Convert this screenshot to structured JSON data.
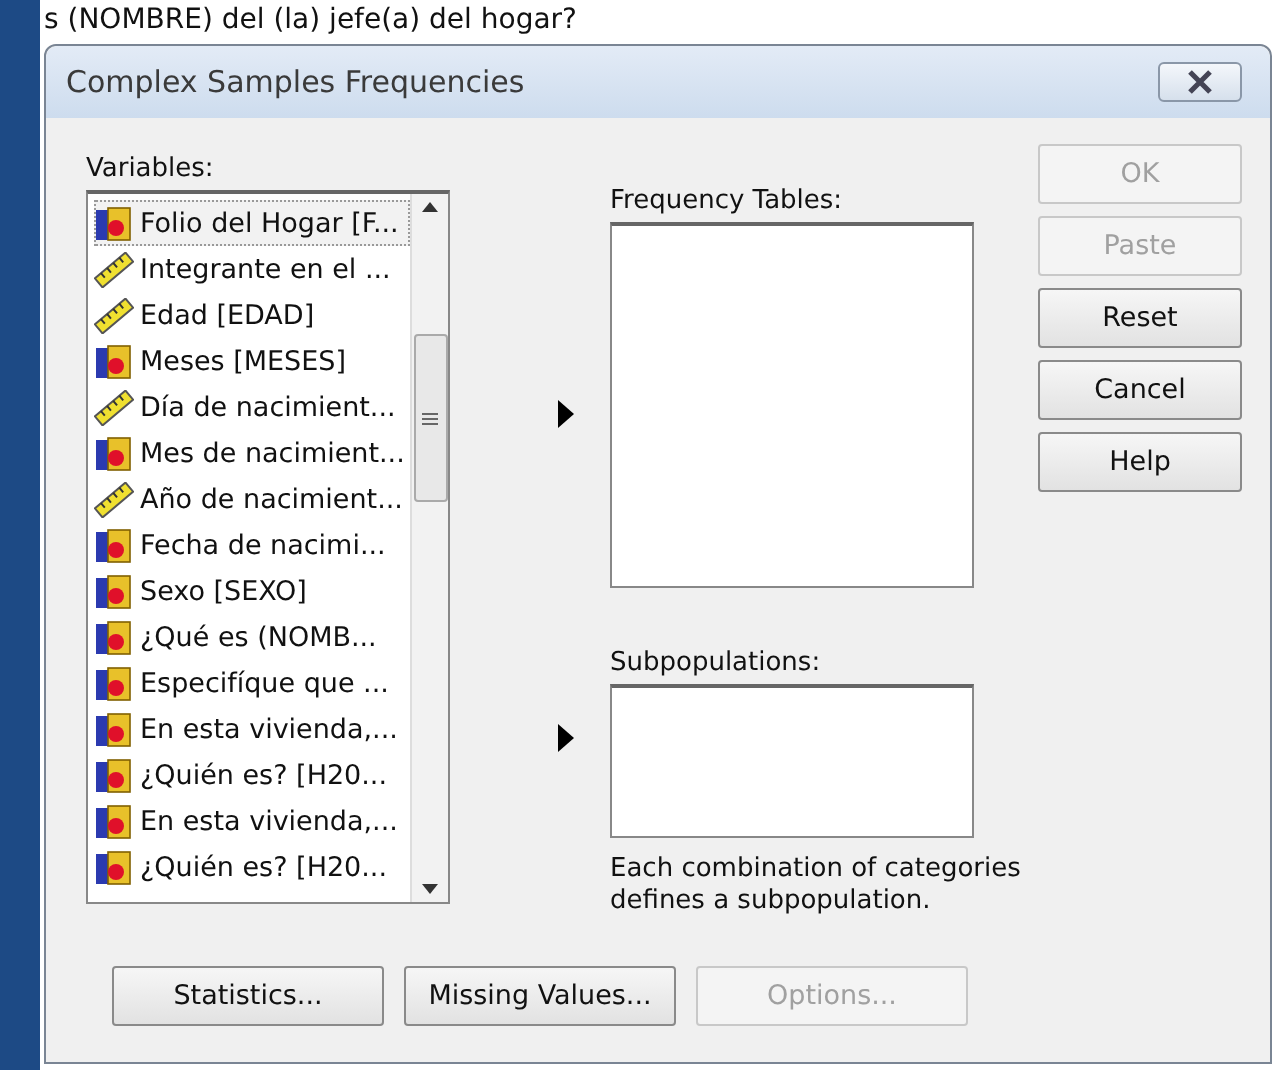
{
  "background_window": {
    "text": "s (NOMBRE) del (la) jefe(a) del hogar?"
  },
  "dialog": {
    "title": "Complex Samples Frequencies"
  },
  "variables": {
    "label": "Variables:",
    "items": [
      {
        "label": "Folio del Hogar [F...",
        "kind": "nominal",
        "selected": true
      },
      {
        "label": "Integrante en el ...",
        "kind": "scale",
        "selected": false
      },
      {
        "label": "Edad [EDAD]",
        "kind": "scale",
        "selected": false
      },
      {
        "label": "Meses [MESES]",
        "kind": "nominal",
        "selected": false
      },
      {
        "label": "Día de nacimient...",
        "kind": "scale",
        "selected": false
      },
      {
        "label": "Mes de nacimient...",
        "kind": "nominal",
        "selected": false
      },
      {
        "label": "Año de nacimient...",
        "kind": "scale",
        "selected": false
      },
      {
        "label": "Fecha de nacimi...",
        "kind": "nominal",
        "selected": false
      },
      {
        "label": "Sexo [SEXO]",
        "kind": "nominal",
        "selected": false
      },
      {
        "label": "¿Qué es (NOMB...",
        "kind": "nominal",
        "selected": false
      },
      {
        "label": "Especifíque que ...",
        "kind": "nominal",
        "selected": false
      },
      {
        "label": "En esta vivienda,...",
        "kind": "nominal",
        "selected": false
      },
      {
        "label": "¿Quién es? [H20...",
        "kind": "nominal",
        "selected": false
      },
      {
        "label": "En esta vivienda,...",
        "kind": "nominal",
        "selected": false
      },
      {
        "label": "¿Quién es? [H20...",
        "kind": "nominal",
        "selected": false
      }
    ]
  },
  "frequency_tables": {
    "label": "Frequency Tables:"
  },
  "subpopulations": {
    "label": "Subpopulations:",
    "note": "Each combination of categories defines a subpopulation."
  },
  "side_buttons": [
    {
      "label": "OK",
      "disabled": true
    },
    {
      "label": "Paste",
      "disabled": true
    },
    {
      "label": "Reset",
      "disabled": false
    },
    {
      "label": "Cancel",
      "disabled": false
    },
    {
      "label": "Help",
      "disabled": false
    }
  ],
  "bottom_buttons": [
    {
      "label": "Statistics...",
      "disabled": false
    },
    {
      "label": "Missing Values...",
      "disabled": false
    },
    {
      "label": "Options...",
      "disabled": true
    }
  ]
}
